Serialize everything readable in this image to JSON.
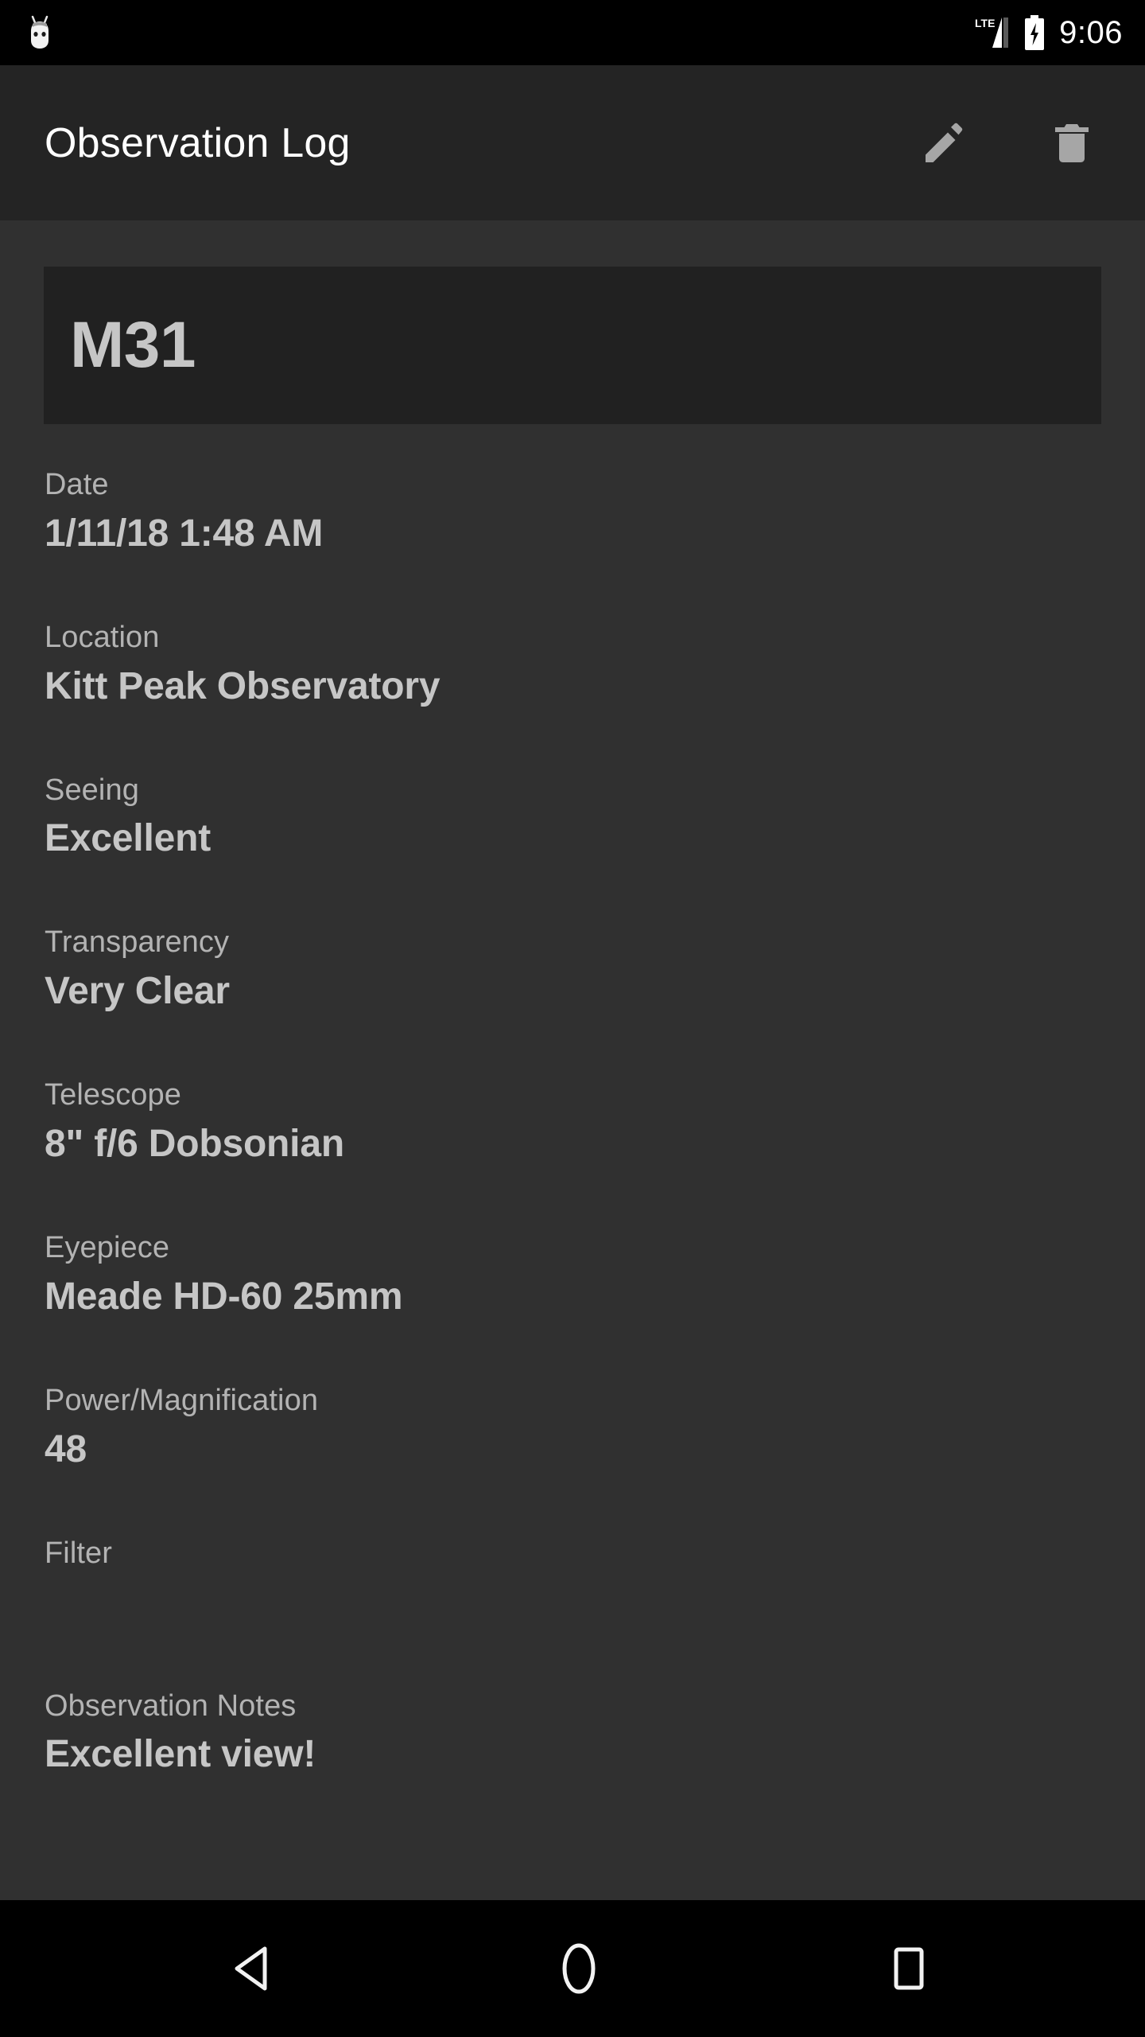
{
  "status_bar": {
    "notification_icon": "cyanogenmod-robot-icon",
    "network_type": "LTE",
    "signal_icon": "signal-bars-icon",
    "battery_icon": "battery-charging-icon",
    "clock": "9:06"
  },
  "app_bar": {
    "title": "Observation Log",
    "actions": [
      {
        "name": "edit-button",
        "icon": "pencil-icon"
      },
      {
        "name": "delete-button",
        "icon": "trash-icon"
      }
    ]
  },
  "detail": {
    "object_name": "M31",
    "fields": [
      {
        "label": "Date",
        "value": "1/11/18 1:48 AM"
      },
      {
        "label": "Location",
        "value": "Kitt Peak Observatory"
      },
      {
        "label": "Seeing",
        "value": "Excellent"
      },
      {
        "label": "Transparency",
        "value": "Very Clear"
      },
      {
        "label": "Telescope",
        "value": "8\" f/6 Dobsonian"
      },
      {
        "label": "Eyepiece",
        "value": "Meade HD-60 25mm"
      },
      {
        "label": "Power/Magnification",
        "value": "48"
      },
      {
        "label": "Filter",
        "value": ""
      },
      {
        "label": "Observation Notes",
        "value": "Excellent view!"
      }
    ]
  },
  "nav_bar": {
    "back_icon": "back-triangle-icon",
    "home_icon": "home-circle-icon",
    "recents_icon": "recents-square-icon"
  },
  "colors": {
    "status_bar_bg": "#000000",
    "app_bar_bg": "#242424",
    "body_bg": "#303030",
    "card_bg": "#212121",
    "label_text": "#b3b3b3",
    "value_text": "#c6c6c6",
    "title_text": "#ffffff",
    "icon_tint": "#a6a6a6"
  }
}
